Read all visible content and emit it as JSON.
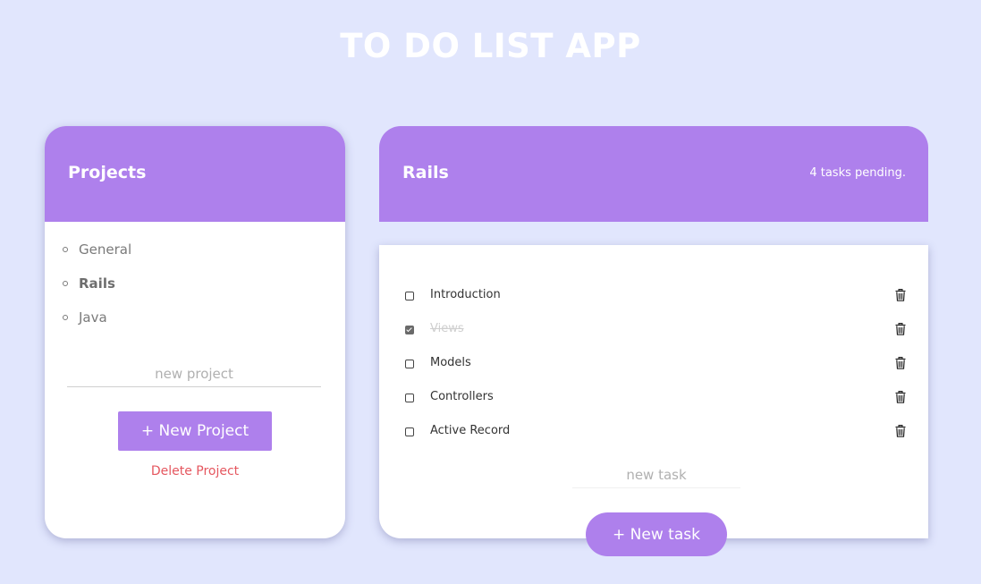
{
  "app": {
    "title": "TO DO LIST APP"
  },
  "colors": {
    "accent": "#ae80ec",
    "background": "#e1e6fd",
    "danger": "#e5575f"
  },
  "projects_panel": {
    "heading": "Projects",
    "items": [
      {
        "label": "General",
        "active": false
      },
      {
        "label": "Rails",
        "active": true
      },
      {
        "label": "Java",
        "active": false
      }
    ],
    "new_project_placeholder": "new project",
    "new_project_value": "",
    "new_project_button": "+ New Project",
    "delete_project_link": "Delete Project"
  },
  "tasks_panel": {
    "heading": "Rails",
    "pending_text": "4 tasks pending.",
    "tasks": [
      {
        "label": "Introduction",
        "done": false,
        "delete_icon": "trash-icon"
      },
      {
        "label": "Views",
        "done": true,
        "delete_icon": "trash-icon"
      },
      {
        "label": "Models",
        "done": false,
        "delete_icon": "trash-icon"
      },
      {
        "label": "Controllers",
        "done": false,
        "delete_icon": "trash-icon"
      },
      {
        "label": "Active Record",
        "done": false,
        "delete_icon": "trash-icon"
      }
    ],
    "new_task_placeholder": "new task",
    "new_task_value": "",
    "new_task_button": "+ New task"
  }
}
